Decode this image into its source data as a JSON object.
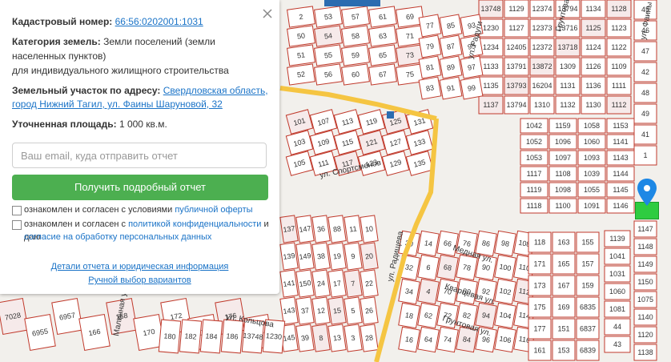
{
  "panel": {
    "cadastral_label": "Кадастровый номер:",
    "cadastral_number": "66:56:0202001:1031",
    "category_label": "Категория земель:",
    "category_value_1": "Земли поселений (земли",
    "category_value_2": "населенных пунктов)",
    "category_value_3": "для индивидуального жилищного строительства",
    "address_label": "Земельный участок по адресу:",
    "address_1": "Свердловская область,",
    "address_2": "город Нижний Тагил, ул. Фаины Шаруновой, 32",
    "area_label": "Уточненная площадь:",
    "area_value": "1 000 кв.м.",
    "email_placeholder": "Ваш email, куда отправить отчет",
    "report_button": "Получить подробный отчет",
    "agree1_text": "ознакомлен и согласен с условиями",
    "agree1_link": "публичной оферты",
    "agree2_text": "ознакомлен и согласен с",
    "agree2_link": "политикой конфиденциальности",
    "agree2_tail": "и даю",
    "agree2_link2": "согласие на обработку персональных данных",
    "details_link": "Детали отчета и юридическая информация",
    "manual_link": "Ручной выбор вариантов"
  },
  "map": {
    "streets": [
      "ул. Спортсменов",
      "ул. Радуги",
      "Грунтовая ул.",
      "ул. Фаины Шаруновой",
      "Медная ул.",
      "Кварцевая ул.",
      "ул. Кольцова",
      "Малинная ул.",
      "Грунтовая ул.",
      "ул. Радищева"
    ],
    "plots": [
      "13748",
      "1230",
      "1234",
      "1133",
      "1135",
      "1137",
      "1129",
      "1127",
      "12405",
      "13791",
      "13793",
      "13794",
      "12374",
      "12373",
      "12372",
      "13872",
      "16204",
      "1310",
      "13794",
      "13716",
      "13718",
      "1309",
      "1131",
      "1132",
      "1134",
      "1125",
      "1124",
      "1126",
      "1136",
      "1130",
      "1128",
      "1123",
      "1122",
      "1109",
      "1111",
      "1112",
      "1042",
      "1052",
      "1053",
      "1117",
      "1119",
      "1118",
      "1159",
      "1096",
      "1097",
      "1108",
      "1098",
      "1100",
      "1058",
      "1060",
      "1093",
      "1039",
      "1055",
      "1091",
      "1153",
      "1141",
      "1143",
      "1144",
      "1145",
      "1146",
      "1147",
      "1148",
      "1149",
      "1150",
      "1075",
      "1140",
      "1120",
      "1138",
      "1139",
      "1041",
      "1031",
      "1060",
      "1081",
      "44",
      "43",
      "45",
      "46",
      "47",
      "42",
      "48",
      "49",
      "41",
      "1",
      "2",
      "50",
      "51",
      "52",
      "53",
      "54",
      "55",
      "56",
      "57",
      "58",
      "59",
      "60",
      "61",
      "63",
      "65",
      "67",
      "69",
      "71",
      "73",
      "75",
      "77",
      "79",
      "81",
      "83",
      "85",
      "87",
      "89",
      "91",
      "93",
      "95",
      "97",
      "99",
      "101",
      "103",
      "105",
      "107",
      "109",
      "111",
      "113",
      "115",
      "117",
      "119",
      "121",
      "123",
      "125",
      "127",
      "129",
      "131",
      "133",
      "135",
      "137",
      "139",
      "141",
      "143",
      "145",
      "147",
      "149",
      "150",
      "37",
      "39",
      "36",
      "38",
      "24",
      "12",
      "8",
      "88",
      "19",
      "17",
      "15",
      "13",
      "11",
      "9",
      "7",
      "5",
      "3",
      "10",
      "20",
      "22",
      "26",
      "28",
      "30",
      "32",
      "34",
      "18",
      "16",
      "14",
      "6",
      "4",
      "62",
      "64",
      "66",
      "68",
      "70",
      "72",
      "74",
      "76",
      "78",
      "80",
      "82",
      "84",
      "86",
      "90",
      "92",
      "94",
      "96",
      "98",
      "100",
      "102",
      "104",
      "106",
      "108",
      "110",
      "112",
      "114",
      "116",
      "118",
      "171",
      "173",
      "175",
      "177",
      "161",
      "163",
      "165",
      "167",
      "169",
      "151",
      "153",
      "155",
      "157",
      "159",
      "6835",
      "6837",
      "6839",
      "7028",
      "6955",
      "6957",
      "166",
      "168",
      "170",
      "172",
      "174",
      "176",
      "178",
      "180",
      "182",
      "184",
      "186"
    ],
    "pin_label": "1031"
  },
  "colors": {
    "boundary": "#c0392b",
    "road": "#f5c542",
    "button": "#4caf50",
    "link": "#1a73c7"
  }
}
